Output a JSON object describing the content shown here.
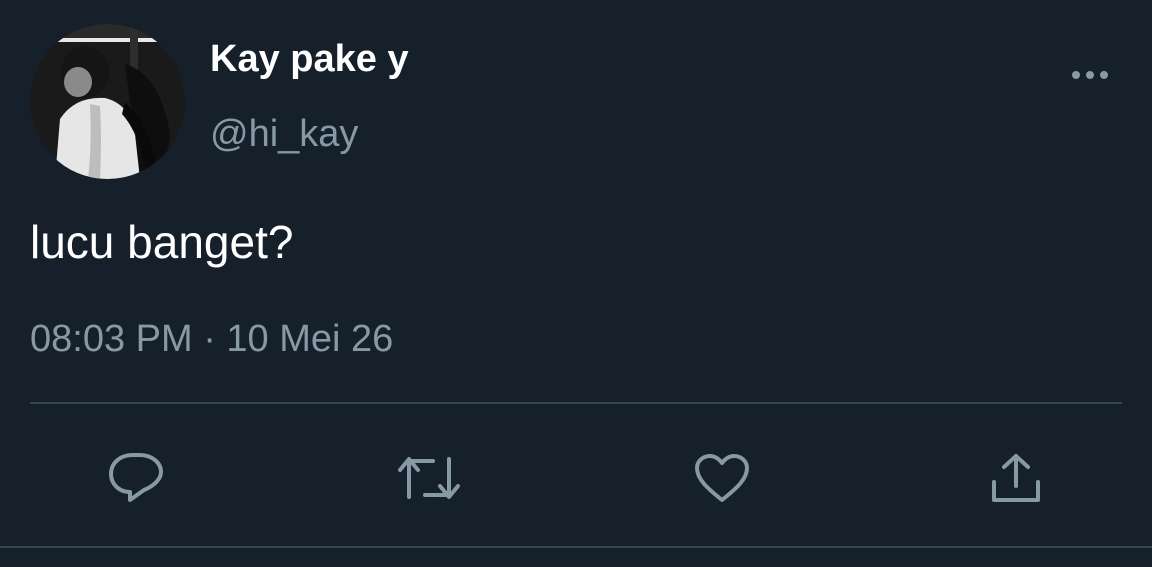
{
  "author": {
    "display_name": "Kay pake y",
    "handle": "@hi_kay"
  },
  "tweet": {
    "text": "lucu banget?",
    "timestamp": "08:03 PM · 10 Mei 26"
  },
  "icons": {
    "more": "more-dots-icon",
    "reply": "reply-icon",
    "retweet": "retweet-icon",
    "like": "heart-icon",
    "share": "share-icon"
  },
  "colors": {
    "background": "#15202b",
    "primary_text": "#ffffff",
    "secondary_text": "#8899a6",
    "divider": "#38444d"
  }
}
